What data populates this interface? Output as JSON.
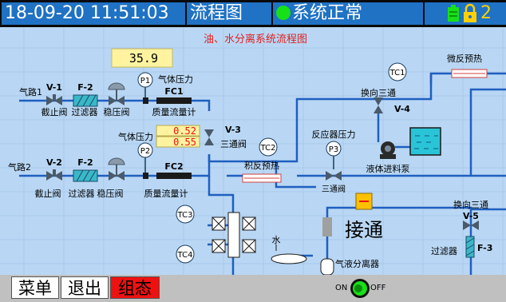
{
  "header": {
    "datetime": "18-09-20 11:51:03",
    "page_title": "流程图",
    "status_text": "系统正常",
    "page_num": "2"
  },
  "diagram": {
    "title": "油、水分离系统流程图",
    "display_value": "35.9",
    "inlet1": "气路1",
    "inlet2": "气路2",
    "v1": "V-1",
    "v2": "V-2",
    "f2a": "F-2",
    "f2b": "F-2",
    "jiezhifa1": "截止阀",
    "jiezhifa2": "截止阀",
    "guolvqi1": "过滤器",
    "guolvqi2": "过滤器",
    "wenyafa1": "稳压阀",
    "wenyafa2": "稳压阀",
    "p1": "P1",
    "p2": "P2",
    "p3": "P3",
    "qiti_yali1": "气体压力",
    "qiti_yali2": "气体压力",
    "fc1": "FC1",
    "fc2": "FC2",
    "zhiliang1": "质量流量计",
    "zhiliang2": "质量流量计",
    "val1": "0.52",
    "val2": "0.55",
    "v3": "V-3",
    "santongfa": "三通阀",
    "tc1": "TC1",
    "tc2": "TC2",
    "tc3": "TC3",
    "tc4": "TC4",
    "weifan_yure": "微反预热",
    "huanxiang_santong1": "换向三通",
    "v4": "V-4",
    "fanyingqi_yali": "反应器压力",
    "ji_fan_yure": "积反预热",
    "santongfa2": "三通阀",
    "yeti_jinliao": "液体进料泵",
    "jietong": "接通",
    "huanxiang_santong2": "换向三通",
    "v5": "V-5",
    "guolvqi3": "过滤器",
    "f3": "F-3",
    "shui": "水",
    "qiye_fenliqi": "气液分离器"
  },
  "footer": {
    "menu": "菜单",
    "back": "退出",
    "zutai": "组态",
    "on": "ON",
    "off": "OFF"
  },
  "colors": {
    "header_bg": "#1f72c4",
    "diagram_bg": "#b9d7f4",
    "pipe": "#1f5fc0",
    "active_button": "#ee1111",
    "status_ok": "#18e018",
    "highlight_value": "#ee1111",
    "display_bg": "#fff3a0"
  },
  "icons": [
    "battery-icon",
    "lock-icon",
    "status-ok-icon",
    "toggle-on-icon"
  ]
}
